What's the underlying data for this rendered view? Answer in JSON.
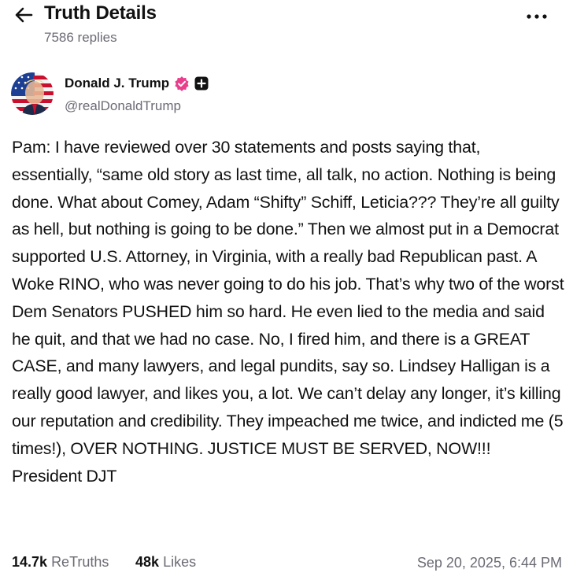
{
  "header": {
    "title": "Truth Details",
    "replies": "7586 replies"
  },
  "author": {
    "display_name": "Donald J. Trump",
    "handle": "@realDonaldTrump"
  },
  "post": {
    "text": "Pam: I have reviewed over 30 statements and posts saying that, essentially, “same old story as last time, all talk, no action. Nothing is being done. What about Comey, Adam “Shifty” Schiff, Leticia??? They’re all guilty as hell, but nothing is going to be done.” Then we almost put in a Democrat supported U.S. Attorney, in Virginia, with a really bad Republican past. A Woke RINO, who was never going to do his job. That’s why two of the worst Dem Senators PUSHED him so hard. He even lied to the media and said he quit, and that we had no case. No, I fired him, and there is a GREAT CASE, and many lawyers, and legal pundits, say so. Lindsey Halligan is a really good lawyer, and likes you, a lot. We can’t delay any longer, it’s killing our reputation and credibility. They impeached me twice, and indicted me (5 times!), OVER NOTHING. JUSTICE MUST BE SERVED, NOW!!! President DJT"
  },
  "stats": {
    "retruths_count": "14.7k",
    "retruths_label": "ReTruths",
    "likes_count": "48k",
    "likes_label": "Likes"
  },
  "timestamp": "Sep 20, 2025, 6:44 PM",
  "icons": {
    "back": "arrow-left-icon",
    "more": "more-horizontal-icon",
    "verified": "verified-badge-icon",
    "plus": "plus-badge-icon"
  },
  "colors": {
    "verified": "#e83e8c",
    "muted_text": "#6b6b75",
    "text": "#111111"
  }
}
